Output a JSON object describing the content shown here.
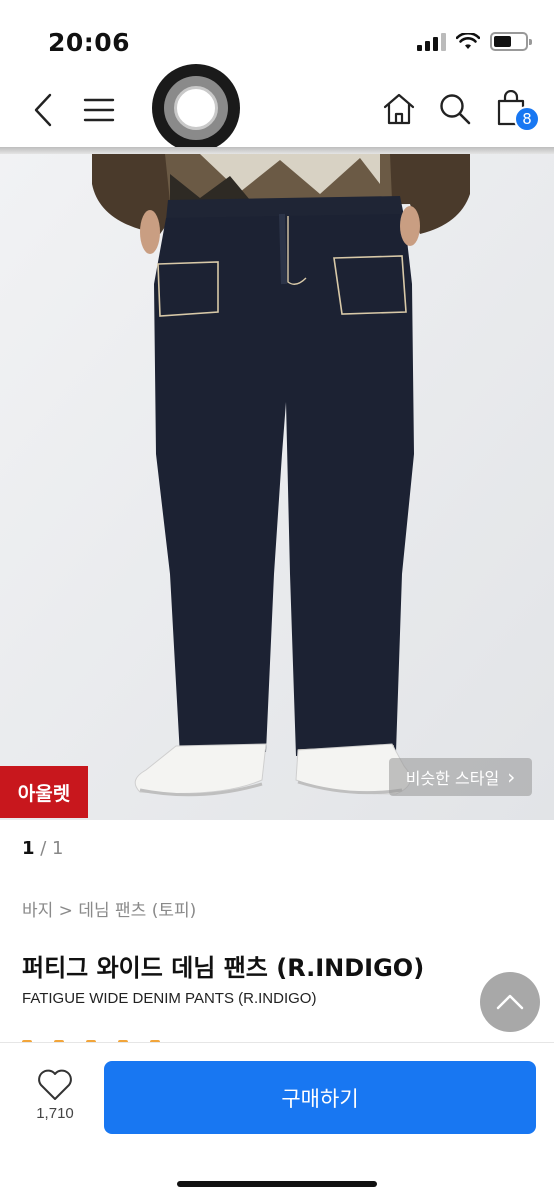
{
  "status": {
    "time": "20:06"
  },
  "header": {
    "cart_count": "8"
  },
  "image": {
    "outlet_badge": "아울렛",
    "similar_style": "비슷한 스타일",
    "similar_chevron": "›"
  },
  "pager": {
    "current": "1",
    "total": " / 1"
  },
  "product": {
    "breadcrumb": "바지 > 데님 팬츠 (토피)",
    "title": "퍼티그 와이드 데님 팬츠 (R.INDIGO)",
    "subtitle": "FATIGUE WIDE DENIM PANTS (R.INDIGO)"
  },
  "bottom": {
    "like_count": "1,710",
    "buy_label": "구매하기"
  },
  "colors": {
    "accent": "#1877f2",
    "outlet": "#c8171d",
    "denim": "#1c2233"
  }
}
